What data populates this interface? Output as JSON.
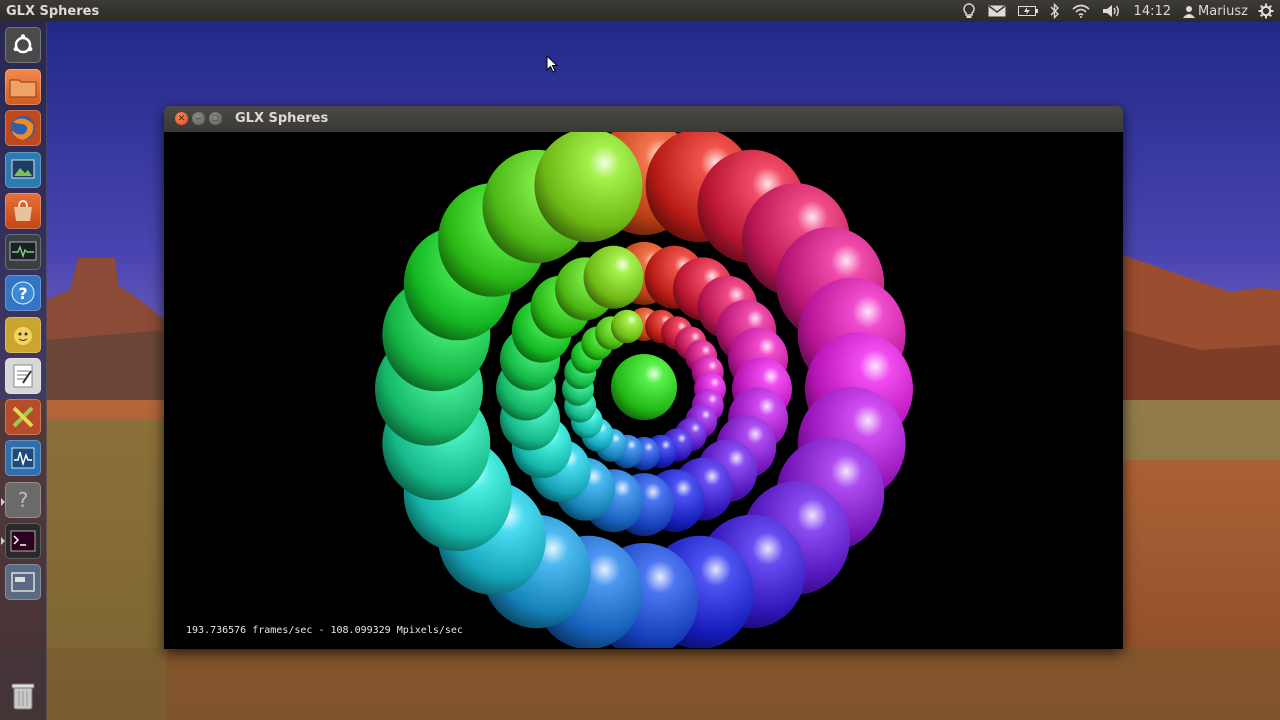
{
  "top_panel": {
    "app_title": "GLX Spheres",
    "clock": "14:12",
    "user": "Mariusz",
    "icons": [
      "lightbulb-icon",
      "mail-icon",
      "battery-icon",
      "bluetooth-icon",
      "wifi-icon",
      "volume-icon",
      "user-icon",
      "gear-icon"
    ]
  },
  "launcher": {
    "items": [
      {
        "name": "dash-home",
        "icon": "ubuntu-logo-icon"
      },
      {
        "name": "files",
        "icon": "folder-icon"
      },
      {
        "name": "firefox",
        "icon": "firefox-icon"
      },
      {
        "name": "image-viewer",
        "icon": "image-icon"
      },
      {
        "name": "software-center",
        "icon": "shopping-bag-icon"
      },
      {
        "name": "system-monitor",
        "icon": "monitor-icon"
      },
      {
        "name": "help",
        "icon": "help-icon"
      },
      {
        "name": "pidgin-like",
        "icon": "chat-icon"
      },
      {
        "name": "text-editor",
        "icon": "text-editor-icon"
      },
      {
        "name": "tools",
        "icon": "tools-icon"
      },
      {
        "name": "monitor-graph",
        "icon": "graph-icon"
      },
      {
        "name": "unknown-app",
        "icon": "question-icon"
      },
      {
        "name": "terminal",
        "icon": "terminal-icon"
      },
      {
        "name": "workspace",
        "icon": "window-icon"
      },
      {
        "name": "trash",
        "icon": "trash-icon"
      }
    ]
  },
  "window": {
    "title": "GLX Spheres",
    "status_text": "193.736576 frames/sec - 108.099329 Mpixels/sec"
  }
}
